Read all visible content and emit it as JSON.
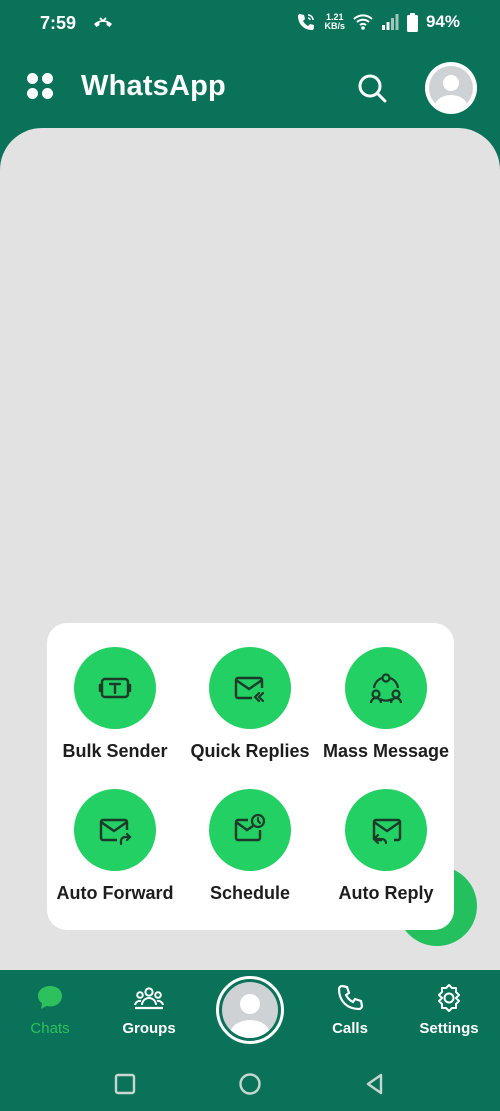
{
  "status_bar": {
    "time": "7:59",
    "speed_value": "1.21",
    "speed_unit": "KB/s",
    "battery": "94%"
  },
  "header": {
    "title": "WhatsApp"
  },
  "tools": [
    {
      "label": "Bulk Sender",
      "icon": "text-box-icon"
    },
    {
      "label": "Quick Replies",
      "icon": "mail-reply-all-icon"
    },
    {
      "label": "Mass Message",
      "icon": "group-connect-icon"
    },
    {
      "label": "Auto Forward",
      "icon": "mail-forward-icon"
    },
    {
      "label": "Schedule",
      "icon": "mail-clock-icon"
    },
    {
      "label": "Auto Reply",
      "icon": "mail-reply-icon"
    }
  ],
  "bottom_nav": {
    "chats": "Chats",
    "groups": "Groups",
    "calls": "Calls",
    "settings": "Settings"
  },
  "colors": {
    "primary": "#0a7259",
    "accent_green": "#23d063",
    "panel_bg": "#e2e2e2",
    "active_nav": "#2ec05c"
  }
}
